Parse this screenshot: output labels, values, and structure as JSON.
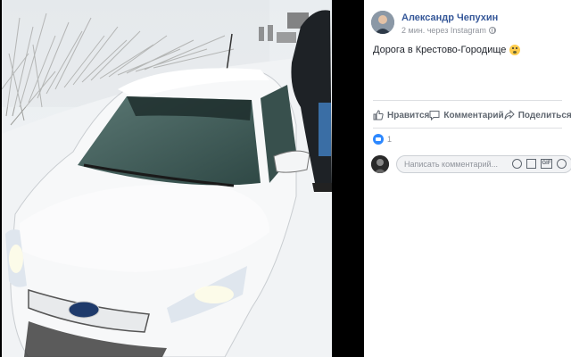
{
  "post": {
    "author": "Александр Чепухин",
    "meta": "2 мин. через Instagram",
    "text": "Дорога в Крестово-Городище",
    "emoji_icon": "scream-emoji-icon"
  },
  "actions": {
    "like": "Нравится",
    "comment": "Комментарий",
    "share": "Поделиться"
  },
  "reactions": {
    "count": "1"
  },
  "comment_box": {
    "placeholder": "Написать комментарий..."
  },
  "colors": {
    "author_link": "#365899",
    "action_text": "#606770",
    "like_badge": "#2d88ff"
  }
}
